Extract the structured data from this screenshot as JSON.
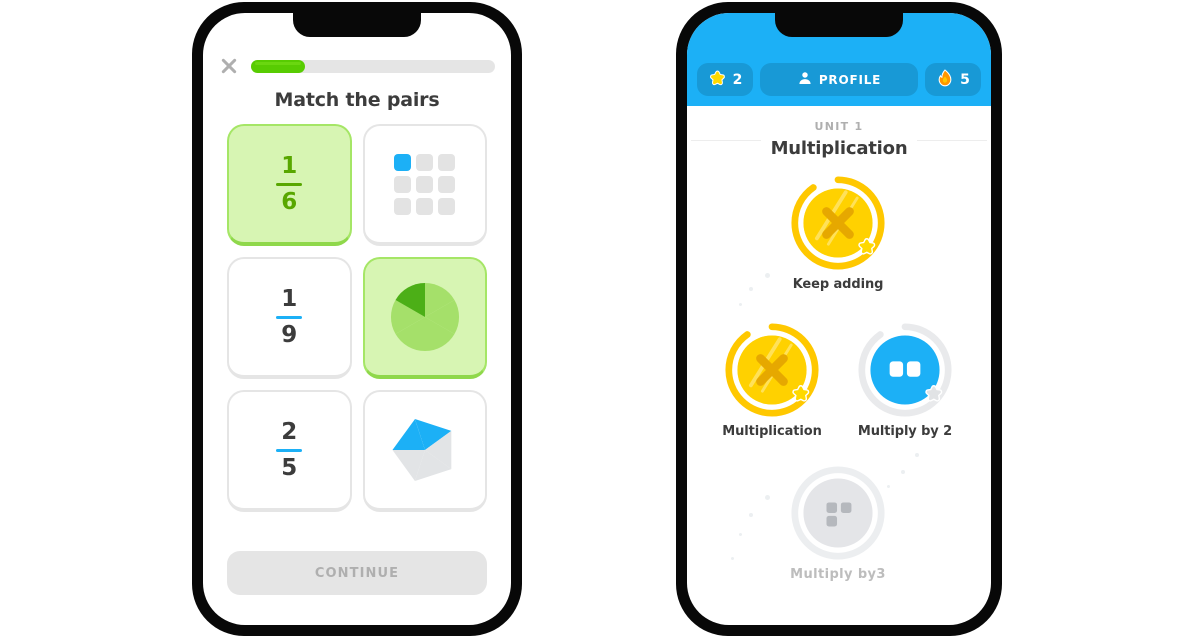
{
  "left_phone": {
    "name": "match-the-pairs-exercise",
    "close_label": "close-icon",
    "progress": {
      "percent": 22,
      "fill_color": "#58cc02",
      "track_color": "#e5e5e5"
    },
    "prompt": "Match the pairs",
    "cards": [
      {
        "id": "card-fraction-1-6",
        "type": "fraction",
        "numerator": "1",
        "denominator": "6",
        "selected": true,
        "icon": ""
      },
      {
        "id": "card-grid-1-9",
        "type": "icon",
        "numerator": "",
        "denominator": "",
        "selected": false,
        "icon": "grid-3x3-icon",
        "filled": 1,
        "total": 9,
        "accent": "#1cb0f6"
      },
      {
        "id": "card-fraction-1-9",
        "type": "fraction",
        "numerator": "1",
        "denominator": "9",
        "selected": false,
        "icon": ""
      },
      {
        "id": "card-pie-1-6",
        "type": "icon",
        "numerator": "",
        "denominator": "",
        "selected": true,
        "icon": "pie-6-slice-icon",
        "filled": 1,
        "total": 6,
        "accent": "#4caf17"
      },
      {
        "id": "card-fraction-2-5",
        "type": "fraction",
        "numerator": "2",
        "denominator": "5",
        "selected": false,
        "icon": ""
      },
      {
        "id": "card-pentagon-2-5",
        "type": "icon",
        "numerator": "",
        "denominator": "",
        "selected": false,
        "icon": "pentagon-5-slice-icon",
        "filled": 2,
        "total": 5,
        "accent": "#1cb0f6"
      }
    ],
    "continue_label": "CONTINUE",
    "continue_enabled": false
  },
  "right_phone": {
    "name": "learning-path-screen",
    "header": {
      "background": "#1cb0f6",
      "pills": [
        {
          "id": "pill-gems",
          "icon": "star-icon",
          "label": "",
          "value": "2"
        },
        {
          "id": "pill-profile",
          "icon": "person-icon",
          "label": "PROFILE",
          "value": ""
        },
        {
          "id": "pill-streak",
          "icon": "flame-icon",
          "label": "",
          "value": "5"
        }
      ]
    },
    "unit": {
      "kicker": "UNIT 1",
      "title": "Multiplication"
    },
    "nodes": [
      {
        "id": "node-keep-adding",
        "label": "Keep adding",
        "state": "complete",
        "icon": "multiply-x-icon",
        "color": "#ffc800",
        "star": true
      },
      {
        "id": "node-multiplication",
        "label": "Multiplication",
        "state": "complete",
        "icon": "multiply-x-icon",
        "color": "#ffc800",
        "star": true
      },
      {
        "id": "node-multiply-by-2",
        "label": "Multiply by 2",
        "state": "active",
        "icon": "two-blocks-icon",
        "color": "#1cb0f6",
        "star": false
      },
      {
        "id": "node-multiply-by-3",
        "label": "Multiply  by3",
        "state": "locked",
        "icon": "three-blocks-icon",
        "color": "#e0e0e0",
        "star": false
      }
    ]
  }
}
